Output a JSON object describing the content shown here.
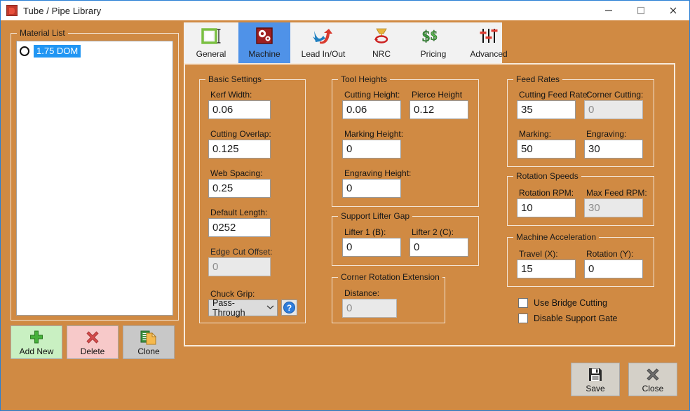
{
  "window": {
    "title": "Tube / Pipe Library",
    "icon": "app-icon",
    "controls": {
      "minimize": "minimize-icon",
      "maximize": "maximize-icon",
      "close": "close-icon"
    }
  },
  "colors": {
    "background": "#d08a43",
    "accent": "#4f92e8",
    "selection": "#2196f3",
    "panel_border": "#f7eadb"
  },
  "material_panel": {
    "group_title": "Material List",
    "items": [
      {
        "label": "1.75 DOM",
        "selected": true
      }
    ],
    "buttons": [
      {
        "name": "add-new",
        "label": "Add New",
        "icon": "plus-icon"
      },
      {
        "name": "delete",
        "label": "Delete",
        "icon": "x-icon"
      },
      {
        "name": "clone",
        "label": "Clone",
        "icon": "copy-icon"
      }
    ]
  },
  "tabs": [
    {
      "label": "General",
      "icon": "square-frame-icon",
      "selected": false
    },
    {
      "label": "Machine",
      "icon": "gears-icon",
      "selected": true
    },
    {
      "label": "Lead In/Out",
      "icon": "arrows-icon",
      "selected": false
    },
    {
      "label": "NRC",
      "icon": "nozzle-rotate-icon",
      "selected": false
    },
    {
      "label": "Pricing",
      "icon": "dollar-icon",
      "selected": false
    },
    {
      "label": "Advanced",
      "icon": "sliders-icon",
      "selected": false
    }
  ],
  "basic_settings": {
    "group_title": "Basic Settings",
    "kerf_width": {
      "label": "Kerf Width:",
      "value": "0.06",
      "disabled": false
    },
    "cutting_overlap": {
      "label": "Cutting Overlap:",
      "value": "0.125",
      "disabled": false
    },
    "web_spacing": {
      "label": "Web Spacing:",
      "value": "0.25",
      "disabled": false
    },
    "default_length": {
      "label": "Default Length:",
      "value": "0252",
      "disabled": false
    },
    "edge_cut_offset": {
      "label": "Edge Cut Offset:",
      "value": "0",
      "disabled": true
    },
    "chuck_grip": {
      "label": "Chuck Grip:",
      "value": "Pass-Through",
      "arrow": "chevron-down-icon"
    },
    "help": "?"
  },
  "tool_heights": {
    "group_title": "Tool Heights",
    "cutting_height": {
      "label": "Cutting Height:",
      "value": "0.06",
      "disabled": false
    },
    "pierce_height": {
      "label": "Pierce Height",
      "value": "0.12",
      "disabled": false
    },
    "marking_height": {
      "label": "Marking Height:",
      "value": "0",
      "disabled": false
    },
    "engraving_height": {
      "label": "Engraving Height:",
      "value": "0",
      "disabled": false
    }
  },
  "support_lifter_gap": {
    "group_title": "Support Lifter Gap",
    "lifter1": {
      "label": "Lifter 1 (B):",
      "value": "0",
      "disabled": false
    },
    "lifter2": {
      "label": "Lifter 2 (C):",
      "value": "0",
      "disabled": false
    }
  },
  "corner_rotation_extension": {
    "group_title": "Corner Rotation Extension",
    "distance": {
      "label": "Distance:",
      "value": "0",
      "disabled": true
    }
  },
  "feed_rates": {
    "group_title": "Feed Rates",
    "cutting_feed_rate": {
      "label": "Cutting Feed Rate:",
      "value": "35",
      "disabled": false
    },
    "corner_cutting": {
      "label": "Corner Cutting:",
      "value": "0",
      "disabled": true
    },
    "marking": {
      "label": "Marking:",
      "value": "50",
      "disabled": false
    },
    "engraving": {
      "label": "Engraving:",
      "value": "30",
      "disabled": false
    }
  },
  "rotation_speeds": {
    "group_title": "Rotation Speeds",
    "rotation_rpm": {
      "label": "Rotation RPM:",
      "value": "10",
      "disabled": false
    },
    "max_feed_rpm": {
      "label": "Max Feed RPM:",
      "value": "30",
      "disabled": true
    }
  },
  "machine_acceleration": {
    "group_title": "Machine Acceleration",
    "travel_x": {
      "label": "Travel (X):",
      "value": "15",
      "disabled": false
    },
    "rotation_y": {
      "label": "Rotation (Y):",
      "value": "0",
      "disabled": false
    }
  },
  "checkboxes": [
    {
      "label": "Use Bridge Cutting",
      "checked": false
    },
    {
      "label": "Disable Support Gate",
      "checked": false
    }
  ],
  "dialog_buttons": [
    {
      "name": "save",
      "label": "Save",
      "icon": "floppy-disk-icon"
    },
    {
      "name": "close",
      "label": "Close",
      "icon": "x-icon"
    }
  ]
}
